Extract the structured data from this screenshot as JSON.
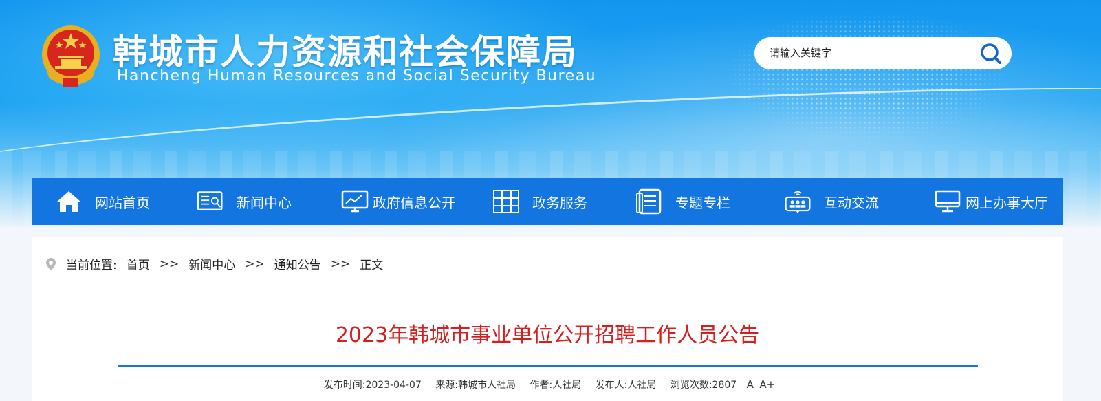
{
  "header": {
    "title": "韩城市人力资源和社会保障局",
    "subtitle": "Hancheng Human Resources and Social Security Bureau",
    "emblem_icon": "national-emblem-icon"
  },
  "search": {
    "placeholder": "请输入关键字",
    "icon": "search-icon"
  },
  "nav": {
    "items": [
      {
        "label": "网站首页",
        "icon": "home-icon"
      },
      {
        "label": "新闻中心",
        "icon": "newspaper-icon"
      },
      {
        "label": "政府信息公开",
        "icon": "monitor-chart-icon"
      },
      {
        "label": "政务服务",
        "icon": "cabinet-icon"
      },
      {
        "label": "专题专栏",
        "icon": "document-icon"
      },
      {
        "label": "互动交流",
        "icon": "chat-group-icon"
      },
      {
        "label": "网上办事大厅",
        "icon": "desktop-icon"
      }
    ]
  },
  "breadcrumb": {
    "prefix": "当前位置:",
    "items": [
      "首页",
      "新闻中心",
      "通知公告",
      "正文"
    ],
    "separator": ">>"
  },
  "article": {
    "title": "2023年韩城市事业单位公开招聘工作人员公告",
    "meta": {
      "publish_time": "发布时间:2023-04-07",
      "source": "来源:韩城市人社局",
      "author": "作者:人社局",
      "publisher": "发布人:人社局",
      "views": "浏览次数:2807",
      "font_small": "A",
      "font_large": "A+"
    }
  },
  "colors": {
    "nav_bg": "#1275e0",
    "title_red": "#d42020",
    "rule_blue": "#1976d2"
  }
}
